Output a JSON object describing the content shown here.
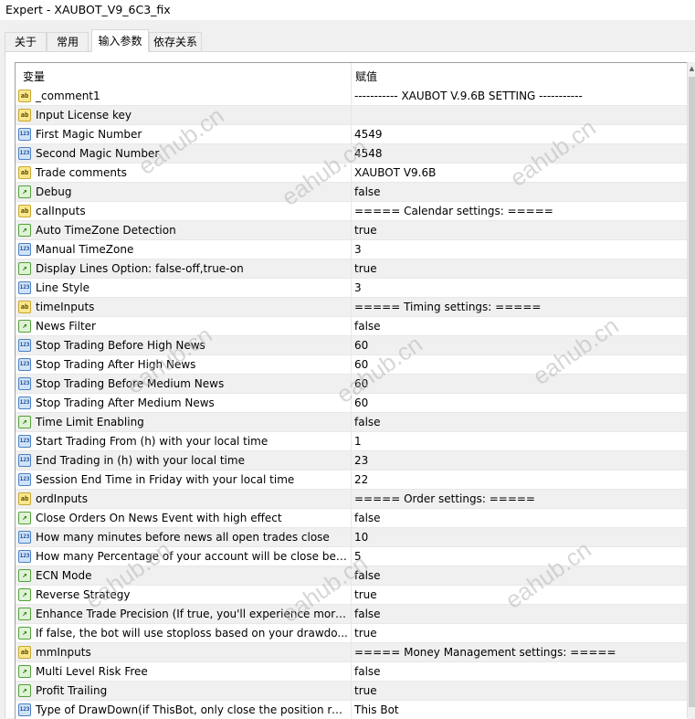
{
  "window": {
    "title": "Expert - XAUBOT_V9_6C3_fix"
  },
  "tabs": [
    "关于",
    "常用",
    "输入参数",
    "依存关系"
  ],
  "header": {
    "name": "变量",
    "value": "赋值"
  },
  "rows": [
    {
      "icon": "ab",
      "name": "_comment1",
      "value": "----------- XAUBOT V.9.6B SETTING -----------"
    },
    {
      "icon": "ab",
      "name": "Input License key",
      "value": ""
    },
    {
      "icon": "123",
      "name": "First Magic Number",
      "value": "4549"
    },
    {
      "icon": "123",
      "name": "Second Magic Number",
      "value": "4548"
    },
    {
      "icon": "ab",
      "name": "Trade comments",
      "value": "XAUBOT V9.6B"
    },
    {
      "icon": "bool",
      "name": "Debug",
      "value": "false"
    },
    {
      "icon": "ab",
      "name": "calInputs",
      "value": "===== Calendar settings: ====="
    },
    {
      "icon": "bool",
      "name": "Auto TimeZone Detection",
      "value": "true"
    },
    {
      "icon": "123",
      "name": "Manual TimeZone",
      "value": "3"
    },
    {
      "icon": "bool",
      "name": "Display Lines Option: false-off,true-on",
      "value": "true"
    },
    {
      "icon": "123",
      "name": "Line Style",
      "value": "3"
    },
    {
      "icon": "ab",
      "name": "timeInputs",
      "value": "===== Timing settings: ====="
    },
    {
      "icon": "bool",
      "name": "News Filter",
      "value": "false"
    },
    {
      "icon": "123",
      "name": "Stop Trading Before High News",
      "value": "60"
    },
    {
      "icon": "123",
      "name": "Stop Trading After High News",
      "value": "60"
    },
    {
      "icon": "123",
      "name": "Stop Trading Before Medium News",
      "value": "60"
    },
    {
      "icon": "123",
      "name": "Stop Trading After Medium News",
      "value": "60"
    },
    {
      "icon": "bool",
      "name": "Time Limit Enabling",
      "value": "false"
    },
    {
      "icon": "123",
      "name": "Start Trading From (h) with your local time",
      "value": "1"
    },
    {
      "icon": "123",
      "name": "End Trading in (h) with your local time",
      "value": "23"
    },
    {
      "icon": "123",
      "name": "Session End Time in Friday with your local time",
      "value": "22"
    },
    {
      "icon": "ab",
      "name": "ordInputs",
      "value": "===== Order settings: ====="
    },
    {
      "icon": "bool",
      "name": "Close Orders On News Event with high effect",
      "value": "false"
    },
    {
      "icon": "123",
      "name": "How many minutes before news all open trades close",
      "value": "10"
    },
    {
      "icon": "123",
      "name": "How many Percentage of your account will be close befo...",
      "value": "5"
    },
    {
      "icon": "bool",
      "name": "ECN Mode",
      "value": "false"
    },
    {
      "icon": "bool",
      "name": "Reverse Strategy",
      "value": "true"
    },
    {
      "icon": "bool",
      "name": "Enhance Trade Precision (If true, you'll experience more ...",
      "value": "false"
    },
    {
      "icon": "bool",
      "name": "If false, the bot will use stoploss based on your drawdo...",
      "value": "true"
    },
    {
      "icon": "ab",
      "name": "mmInputs",
      "value": "===== Money Management settings: ====="
    },
    {
      "icon": "bool",
      "name": "Multi Level Risk Free",
      "value": "false"
    },
    {
      "icon": "bool",
      "name": "Profit Trailing",
      "value": "true"
    },
    {
      "icon": "123",
      "name": "Type of DrawDown(if ThisBot, only close the position rela...",
      "value": "This Bot"
    }
  ],
  "icon_glyphs": {
    "ab": "ab",
    "123": "123",
    "bool": "↗"
  },
  "watermark": "eahub.cn"
}
